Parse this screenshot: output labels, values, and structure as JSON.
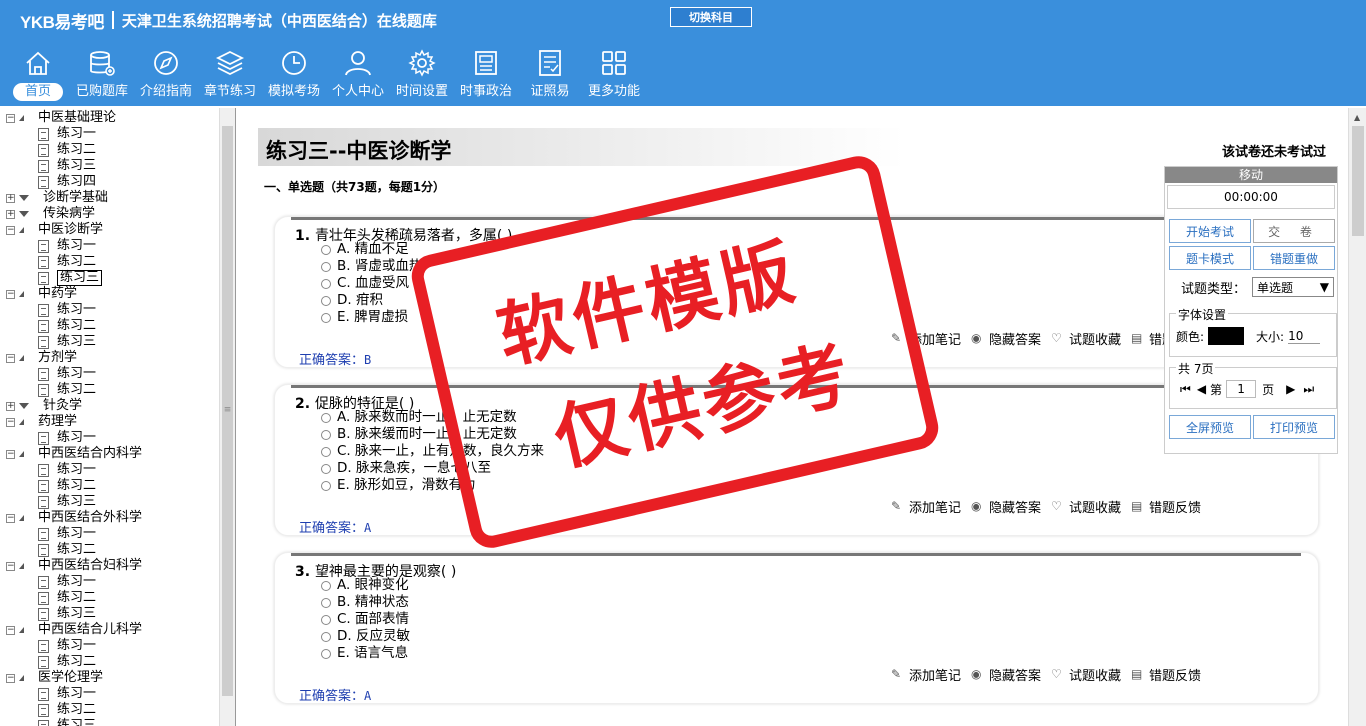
{
  "header": {
    "brand": "YKB易考吧",
    "exam_title": "天津卫生系统招聘考试（中西医结合）在线题库",
    "switch_label": "切换科目",
    "nav": [
      {
        "label": "首页",
        "icon": "home-icon"
      },
      {
        "label": "已购题库",
        "icon": "database-icon"
      },
      {
        "label": "介绍指南",
        "icon": "compass-icon"
      },
      {
        "label": "章节练习",
        "icon": "layers-icon"
      },
      {
        "label": "模拟考场",
        "icon": "clock-icon"
      },
      {
        "label": "个人中心",
        "icon": "user-icon"
      },
      {
        "label": "时间设置",
        "icon": "gear-icon"
      },
      {
        "label": "时事政治",
        "icon": "newspaper-icon"
      },
      {
        "label": "证照易",
        "icon": "checklist-icon"
      },
      {
        "label": "更多功能",
        "icon": "grid-icon"
      }
    ]
  },
  "tree": {
    "nodes": [
      {
        "type": "folder",
        "label": "中医基础理论",
        "open": true
      },
      {
        "type": "leaf",
        "label": "练习一"
      },
      {
        "type": "leaf",
        "label": "练习二"
      },
      {
        "type": "leaf",
        "label": "练习三"
      },
      {
        "type": "leaf",
        "label": "练习四"
      },
      {
        "type": "folder",
        "label": "诊断学基础",
        "open": false
      },
      {
        "type": "folder",
        "label": "传染病学",
        "open": false
      },
      {
        "type": "folder",
        "label": "中医诊断学",
        "open": true
      },
      {
        "type": "leaf",
        "label": "练习一"
      },
      {
        "type": "leaf",
        "label": "练习二"
      },
      {
        "type": "leaf",
        "label": "练习三",
        "selected": true
      },
      {
        "type": "folder",
        "label": "中药学",
        "open": true
      },
      {
        "type": "leaf",
        "label": "练习一"
      },
      {
        "type": "leaf",
        "label": "练习二"
      },
      {
        "type": "leaf",
        "label": "练习三"
      },
      {
        "type": "folder",
        "label": "方剂学",
        "open": true
      },
      {
        "type": "leaf",
        "label": "练习一"
      },
      {
        "type": "leaf",
        "label": "练习二"
      },
      {
        "type": "folder",
        "label": "针灸学",
        "open": false
      },
      {
        "type": "folder",
        "label": "药理学",
        "open": true
      },
      {
        "type": "leaf",
        "label": "练习一"
      },
      {
        "type": "folder",
        "label": "中西医结合内科学",
        "open": true
      },
      {
        "type": "leaf",
        "label": "练习一"
      },
      {
        "type": "leaf",
        "label": "练习二"
      },
      {
        "type": "leaf",
        "label": "练习三"
      },
      {
        "type": "folder",
        "label": "中西医结合外科学",
        "open": true
      },
      {
        "type": "leaf",
        "label": "练习一"
      },
      {
        "type": "leaf",
        "label": "练习二"
      },
      {
        "type": "folder",
        "label": "中西医结合妇科学",
        "open": true
      },
      {
        "type": "leaf",
        "label": "练习一"
      },
      {
        "type": "leaf",
        "label": "练习二"
      },
      {
        "type": "leaf",
        "label": "练习三"
      },
      {
        "type": "folder",
        "label": "中西医结合儿科学",
        "open": true
      },
      {
        "type": "leaf",
        "label": "练习一"
      },
      {
        "type": "leaf",
        "label": "练习二"
      },
      {
        "type": "folder",
        "label": "医学伦理学",
        "open": true
      },
      {
        "type": "leaf",
        "label": "练习一"
      },
      {
        "type": "leaf",
        "label": "练习二"
      },
      {
        "type": "leaf",
        "label": "练习三"
      }
    ]
  },
  "main": {
    "title": "练习三--中医诊断学",
    "status": "该试卷还未考试过",
    "section": "一、单选题（共73题，每题1分）",
    "tools": [
      "添加笔记",
      "隐藏答案",
      "试题收藏",
      "错题反馈"
    ],
    "answer_label": "正确答案：",
    "questions": [
      {
        "num": "1.",
        "text": "青壮年头发稀疏易落者，多属(  )",
        "options": [
          "A. 精血不足",
          "B. 肾虚或血热",
          "C. 血虚受风",
          "D. 疳积",
          "E. 脾胃虚损"
        ],
        "answer": "B"
      },
      {
        "num": "2.",
        "text": "促脉的特征是(  )",
        "options": [
          "A. 脉来数而时一止，止无定数",
          "B. 脉来缓而时一止，止无定数",
          "C. 脉来一止，止有定数，良久方来",
          "D. 脉来急疾，一息七八至",
          "E. 脉形如豆，滑数有力"
        ],
        "answer": "A"
      },
      {
        "num": "3.",
        "text": "望神最主要的是观察(  )",
        "options": [
          "A. 眼神变化",
          "B. 精神状态",
          "C. 面部表情",
          "D. 反应灵敏",
          "E. 语言气息"
        ],
        "answer": "A"
      }
    ]
  },
  "panel": {
    "move_label": "移动",
    "timer": "00:00:00",
    "start_label": "开始考试",
    "submit_label": "交 卷",
    "card_mode_label": "题卡模式",
    "redo_label": "错题重做",
    "type_label": "试题类型：",
    "type_value": "单选题",
    "font_legend": "字体设置",
    "color_label": "颜色:",
    "color_value": "#000000",
    "size_label": "大小:",
    "size_value": "10",
    "pages_legend": "共 7页",
    "page_prefix": "第",
    "page_value": "1",
    "page_suffix": "页",
    "fullscreen_label": "全屏预览",
    "print_label": "打印预览"
  },
  "watermark": {
    "line1": "软件模版",
    "line2": "仅供参考"
  }
}
